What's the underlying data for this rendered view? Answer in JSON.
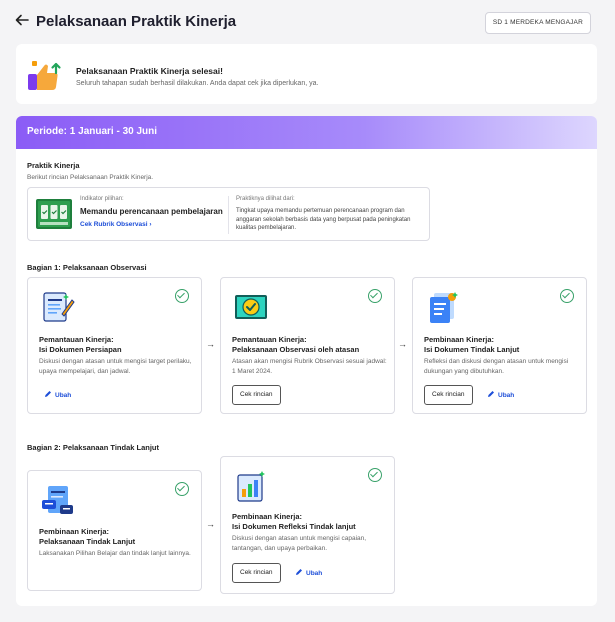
{
  "header": {
    "back_icon": "arrow-left-icon",
    "title": "Pelaksanaan Praktik Kinerja",
    "school_label": "SD 1 MERDEKA MENGAJAR"
  },
  "banner": {
    "icon": "thumbs-up-icon",
    "title": "Pelaksanaan Praktik Kinerja selesai!",
    "subtitle": "Seluruh tahapan sudah berhasil dilakukan. Anda dapat cek jika diperlukan, ya."
  },
  "period": {
    "label": "Periode: 1 Januari - 30 Juni"
  },
  "practice": {
    "title": "Praktik Kinerja",
    "subtitle": "Berikut rincian Pelaksanaan Praktik Kinerja.",
    "indicator_label": "Indikator pilihan:",
    "indicator_value": "Memandu perencanaan pembelajaran",
    "rubric_link": "Cek Rubrik Observasi",
    "observed_label": "Praktiknya dilihat dari:",
    "observed_text": "Tingkat upaya memandu pertemuan perencanaan program dan anggaran sekolah berbasis data yang berpusat pada peningkatan kualitas pembelajaran."
  },
  "part1": {
    "title": "Bagian 1: Pelaksanaan Observasi",
    "cards": [
      {
        "title1": "Pemantauan Kinerja:",
        "title2": "Isi Dokumen Persiapan",
        "desc": "Diskusi dengan atasan untuk mengisi target perilaku, upaya mempelajari, dan jadwal.",
        "edit": "Ubah"
      },
      {
        "title1": "Pemantauan Kinerja:",
        "title2": "Pelaksanaan Observasi oleh atasan",
        "desc": "Atasan akan mengisi Rubrik Observasi sesuai jadwal: 1 Maret 2024.",
        "button": "Cek rincian"
      },
      {
        "title1": "Pembinaan Kinerja:",
        "title2": "Isi Dokumen Tindak Lanjut",
        "desc": "Refleksi dan diskusi dengan atasan untuk mengisi dukungan yang dibutuhkan.",
        "button": "Cek rincian",
        "edit": "Ubah"
      }
    ]
  },
  "part2": {
    "title": "Bagian 2: Pelaksanaan Tindak Lanjut",
    "cards": [
      {
        "title1": "Pembinaan Kinerja:",
        "title2": "Pelaksanaan Tindak Lanjut",
        "desc": "Laksanakan Pilihan Belajar dan tindak lanjut lainnya."
      },
      {
        "title1": "Pembinaan Kinerja:",
        "title2": "Isi Dokumen Refleksi Tindak lanjut",
        "desc": "Diskusi dengan atasan untuk mengisi capaian, tantangan, dan upaya perbaikan.",
        "button": "Cek rincian",
        "edit": "Ubah"
      }
    ]
  },
  "colors": {
    "accent": "#8b5cf6",
    "check": "#38a169",
    "link": "#1d4ed8"
  }
}
